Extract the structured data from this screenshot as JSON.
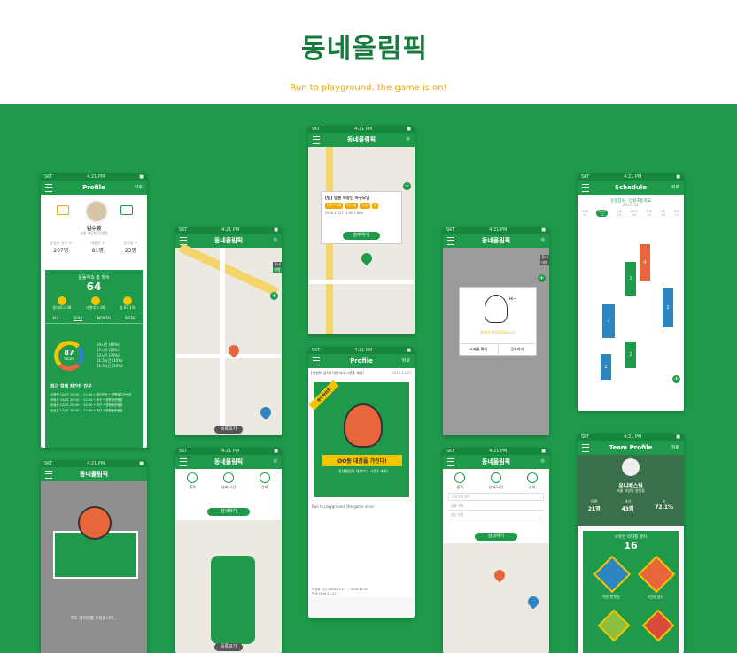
{
  "brand": {
    "logo_text": "동네올림픽",
    "tagline": "Run to playground, the game is on!"
  },
  "status_bar": {
    "carrier": "SKT",
    "time": "4:21 PM"
  },
  "screens": {
    "profile": {
      "title": "Profile",
      "right_label": "뒤로",
      "user_name": "김수영",
      "user_sub": "서울 자양동 양원동",
      "stats_labels": [
        "운동한 친구 수",
        "대항전 수",
        "운동장 수"
      ],
      "stats_values": [
        "207명",
        "81명",
        "23명"
      ],
      "total_label": "운동약속 총 횟수",
      "total_value": "64",
      "badges": [
        {
          "label": "동네리그",
          "value": "38"
        },
        {
          "label": "대항리그",
          "value": "26"
        },
        {
          "label": "승",
          "value": "67.1%"
        }
      ],
      "tabs": [
        "ALL",
        "YEAR",
        "MONTH",
        "WEEK"
      ],
      "donut_value": "87",
      "donut_unit": "hours",
      "legend": [
        "24시간 (40%)",
        "17시간 (20%)",
        "12시간 (20%)",
        "11.5시간 (10%)",
        "11.5시간 (10%)"
      ],
      "recent_title": "최근 함께 참가한 친구",
      "recent_rows": [
        "김종민 12/07 19:30 ~ 21:00 • 배드민턴 • 양원동주민센터",
        "지동규 12/01 20:30 ~ 22:00 • 축구 • 양원동운동장",
        "송동윤 12/01 20:30 ~ 22:00 • 축구 • 양원동운동장",
        "김승훈 12/01 20:30 ~ 22:00 • 축구 • 양원동운동장"
      ]
    },
    "map_main": {
      "side_tabs": [
        "동네",
        "대항"
      ],
      "list_button": "목록보기",
      "pin_count_a": "2",
      "pin_count_b": "4"
    },
    "popup": {
      "title": "[팀] 양원 직장인 야구모임",
      "tags": [
        "야구 • 6명",
        "9/12명",
        "20대",
        "남"
      ],
      "date": "2016.11.07 21:00",
      "distance": "1.8km",
      "button": "참여하기",
      "side_tabs": [
        "동네",
        "대항"
      ]
    },
    "success": {
      "greeting": "Hi~",
      "message": "참여가 완료되었습니다!",
      "left_btn": "스케줄 확인",
      "right_btn": "공유하기"
    },
    "schedule": {
      "title": "Schedule",
      "right_label": "뒤로",
      "filter": "운동장소 : 양원초등학교",
      "month": "2016.12",
      "days": [
        "SUN",
        "MON",
        "TUE",
        "WED",
        "THU",
        "FRI",
        "SAT"
      ],
      "dates": [
        "11",
        "12",
        "13",
        "14",
        "15",
        "16",
        "17"
      ],
      "block_numbers": [
        "4",
        "1",
        "2",
        "2",
        "2",
        "1"
      ]
    },
    "event": {
      "title": "Profile",
      "right_label": "뒤로",
      "notice": "[이벤트 공지] 대항리그 시즌1 개최!",
      "notice_date": "2016.11.07",
      "ribbon": "event",
      "banner_title": "OO동 대장을 가린다!",
      "banner_sub": "동네올림픽 대항리그 시즌1 개최!",
      "body": "Run to playground, the game is on!",
      "footer_rows": [
        "이벤트 기간  2016.11.07 ~ 2016.11.30",
        "안내  2016.11.21"
      ]
    },
    "search": {
      "options": [
        "종목",
        "날짜/시간",
        "상태"
      ],
      "button": "검색하기",
      "side_tabs": [
        "동네",
        "대항"
      ],
      "list_button": "목록보기",
      "fields": [
        "운동장을 검색",
        "날짜 선택",
        "참가 인원"
      ]
    },
    "splash": {
      "message": "지도 데이터를 로딩합니다..."
    },
    "team": {
      "title": "Team Profile",
      "right_label": "뒤로",
      "team_name": "유니베스팀",
      "team_sub": "서울 자양동 양원동",
      "stat_labels": [
        "팀원",
        "경기",
        "승"
      ],
      "stat_values": [
        "21명",
        "43회",
        "72.1%"
      ],
      "badge_title": "보유한 타이틀 뱃지",
      "badge_count": "16",
      "badge_labels": [
        "역전 한판승",
        "5연승 달성"
      ]
    }
  },
  "colors": {
    "green": "#1f9a4b",
    "dark_green": "#17863d",
    "yellow": "#f3c400",
    "orange": "#e8663b",
    "blue": "#2e86c1"
  }
}
